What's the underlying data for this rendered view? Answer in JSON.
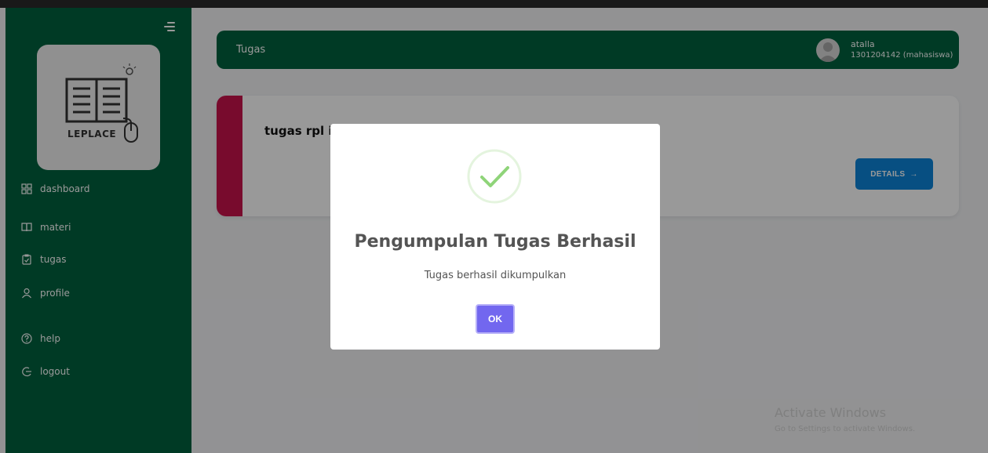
{
  "app": {
    "logo_text": "LEPLACE"
  },
  "sidebar": {
    "items": [
      {
        "label": "dashboard",
        "icon": "grid-icon"
      },
      {
        "label": "materi",
        "icon": "book-icon"
      },
      {
        "label": "tugas",
        "icon": "clipboard-check-icon"
      },
      {
        "label": "profile",
        "icon": "user-icon"
      },
      {
        "label": "help",
        "icon": "help-icon"
      },
      {
        "label": "logout",
        "icon": "logout-icon"
      }
    ]
  },
  "header": {
    "title": "Tugas",
    "user_name": "atalla",
    "user_id": "1301204142 (mahasiswa)"
  },
  "task": {
    "title": "tugas rpl impal",
    "details_label": "DETAILS"
  },
  "modal": {
    "title": "Pengumpulan Tugas Berhasil",
    "message": "Tugas berhasil dikumpulkan",
    "ok_label": "OK"
  },
  "watermark": {
    "line1": "Activate Windows",
    "line2": "Go to Settings to activate Windows."
  },
  "colors": {
    "sidebar_bg": "#00613f",
    "task_accent": "#c8134c",
    "details_button": "#0d84d9",
    "ok_button": "#7267ef",
    "success_check": "#8fd479"
  }
}
